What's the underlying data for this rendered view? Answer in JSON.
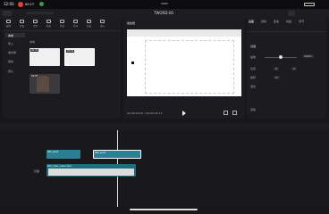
{
  "status": {
    "time": "12:03",
    "rec_time": "00:17"
  },
  "project": {
    "title": "TWORD-00",
    "export_label": "导出"
  },
  "media": {
    "tools": [
      "媒体",
      "音频",
      "文本",
      "贴纸",
      "特效",
      "转场",
      "滤镜",
      "调节"
    ],
    "side": [
      "本地",
      "导入",
      "素材库",
      "我的",
      "默认"
    ],
    "sub_tabs": [
      "本地",
      "导入"
    ],
    "clips": [
      {
        "duration": "00:03",
        "type": "doc"
      },
      {
        "duration": "00:02",
        "type": "doc"
      },
      {
        "duration": "00:05",
        "type": "portrait"
      }
    ]
  },
  "player": {
    "title": "播放器",
    "time": "00:00:00:00 / 00:00:05:13"
  },
  "props": {
    "tabs": [
      "画面",
      "音频",
      "变速",
      "动画",
      "调节"
    ],
    "sections": [
      "基础",
      "缩放",
      "位置",
      "旋转",
      "混合",
      "蒙版"
    ],
    "scale_value": "100%",
    "position_x": "0",
    "position_y": "0",
    "rotate_value": "0°",
    "scale_level": 0.5
  },
  "timeline": {
    "clips": [
      {
        "label": "001_word",
        "track": 1
      },
      {
        "label": "002_word",
        "track": 1
      },
      {
        "label": "003_main_video.mp4",
        "track": 2
      }
    ],
    "cover_label": "封面"
  }
}
